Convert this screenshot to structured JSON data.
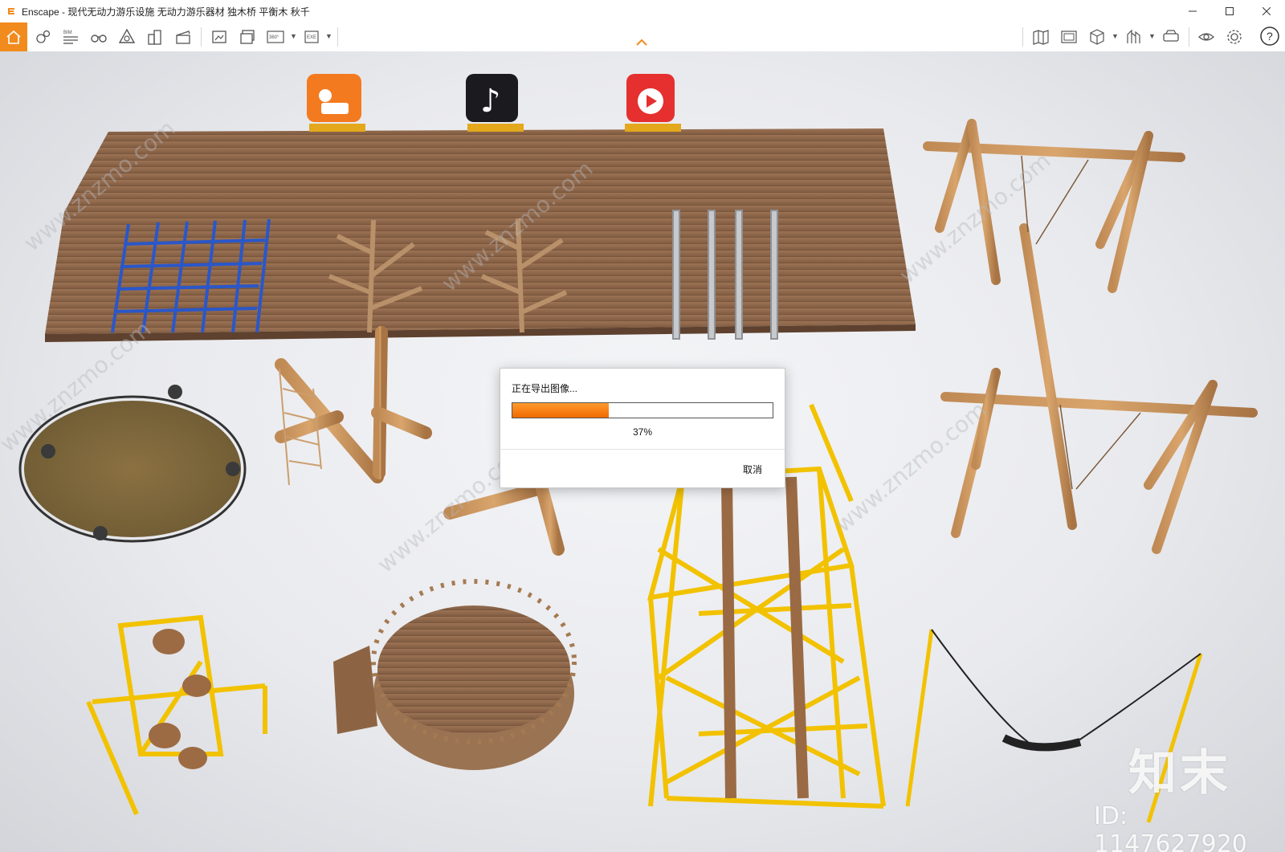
{
  "window": {
    "title": "Enscape - 现代无动力游乐设施 无动力游乐器材 独木桥 平衡木 秋千",
    "minimize_icon": "minimize-icon",
    "maximize_icon": "maximize-icon",
    "close_icon": "close-icon"
  },
  "toolbar": {
    "bim_label": "BIM",
    "panorama_label": "360°",
    "exe_label": "EXE",
    "accent_color": "#f28b1e",
    "left_icons": [
      "home-icon",
      "render-settings-icon",
      "bim-icon",
      "binoculars-icon",
      "asset-library-icon",
      "buildings-icon",
      "video-editor-icon",
      "screenshot-icon",
      "batch-render-icon",
      "panorama-icon",
      "export-exe-icon"
    ],
    "right_icons": [
      "map-icon",
      "view-management-icon",
      "cube-view-icon",
      "chart-icon",
      "vr-headset-icon",
      "visibility-icon",
      "settings-icon",
      "help-icon"
    ]
  },
  "scene": {
    "platform_badges": [
      "kuaishou-icon",
      "douyin-icon",
      "huoshan-icon"
    ],
    "watermark_text": "www.znzmo.com",
    "watermark_logo": "知末",
    "watermark_id": "ID: 1147627920"
  },
  "dialog": {
    "title": "正在导出图像...",
    "progress_percent": 37,
    "progress_text": "37%",
    "cancel_label": "取消",
    "progress_color": "#f47a0c"
  }
}
